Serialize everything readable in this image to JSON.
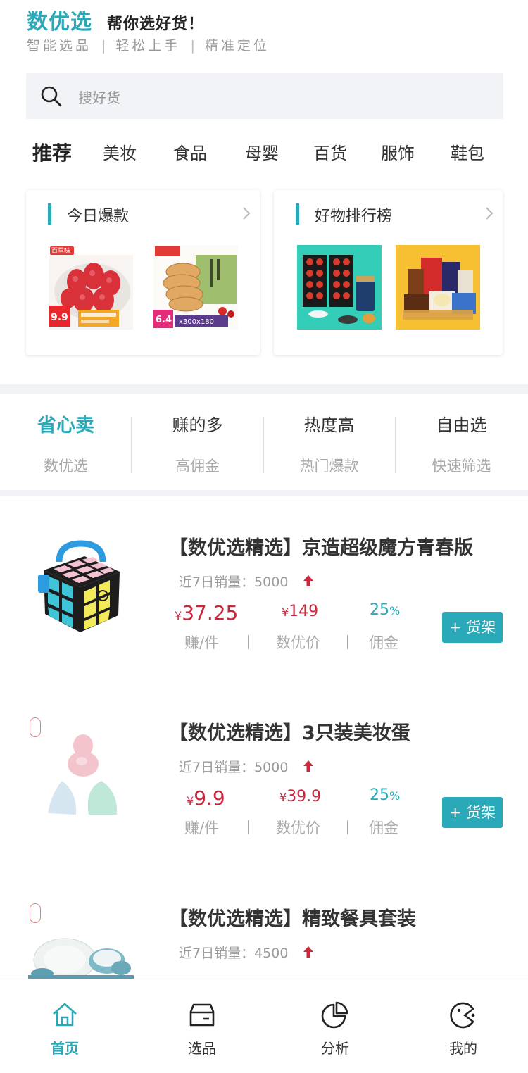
{
  "header": {
    "brand": "数优选",
    "slogan": "帮你选好货！",
    "features": [
      "智能选品",
      "轻松上手",
      "精准定位"
    ]
  },
  "search": {
    "placeholder": "搜好货"
  },
  "categories": [
    "推荐",
    "美妆",
    "食品",
    "母婴",
    "百货",
    "服饰",
    "鞋包"
  ],
  "cards": [
    {
      "title": "今日爆款",
      "thumbs": [
        "strawberry-snack-bag",
        "biscuit-box"
      ],
      "thumb_texts": [
        "百草味",
        "9.9",
        "6.4",
        "300",
        "180"
      ]
    },
    {
      "title": "好物排行榜",
      "thumbs": [
        "tea-gift-set",
        "snack-gift-pack"
      ]
    }
  ],
  "sell_tabs": [
    {
      "title": "省心卖",
      "subtitle": "数优选"
    },
    {
      "title": "赚的多",
      "subtitle": "高佣金"
    },
    {
      "title": "热度高",
      "subtitle": "热门爆款"
    },
    {
      "title": "自由选",
      "subtitle": "快速筛选"
    }
  ],
  "products": [
    {
      "title": "【数优选精选】京造超级魔方青春版",
      "sales_label": "近7日销量：",
      "sales": "5000",
      "earn": "37.25",
      "price": "149",
      "commission": "25",
      "currency": "¥",
      "percent": "%",
      "labels": [
        "赚/件",
        "数优价",
        "佣金"
      ],
      "button": "+ 货架",
      "image": "smart-rubiks-cube"
    },
    {
      "title": "【数优选精选】3只装美妆蛋",
      "sales_label": "近7日销量：",
      "sales": "5000",
      "earn": "9.9",
      "price": "39.9",
      "commission": "25",
      "currency": "¥",
      "percent": "%",
      "labels": [
        "赚/件",
        "数优价",
        "佣金"
      ],
      "button": "+ 货架",
      "image": "makeup-sponges"
    },
    {
      "title": "【数优选精选】精致餐具套装",
      "sales_label": "近7日销量：",
      "sales": "4500",
      "image": "tableware-set"
    }
  ],
  "tabbar": [
    {
      "label": "首页",
      "icon": "home-icon",
      "active": true
    },
    {
      "label": "选品",
      "icon": "box-icon",
      "active": false
    },
    {
      "label": "分析",
      "icon": "pie-chart-icon",
      "active": false
    },
    {
      "label": "我的",
      "icon": "user-face-icon",
      "active": false
    }
  ],
  "colors": {
    "accent": "#2aa9b8",
    "price": "#c8283c",
    "muted": "#999999",
    "divider": "#f2f3f6"
  }
}
